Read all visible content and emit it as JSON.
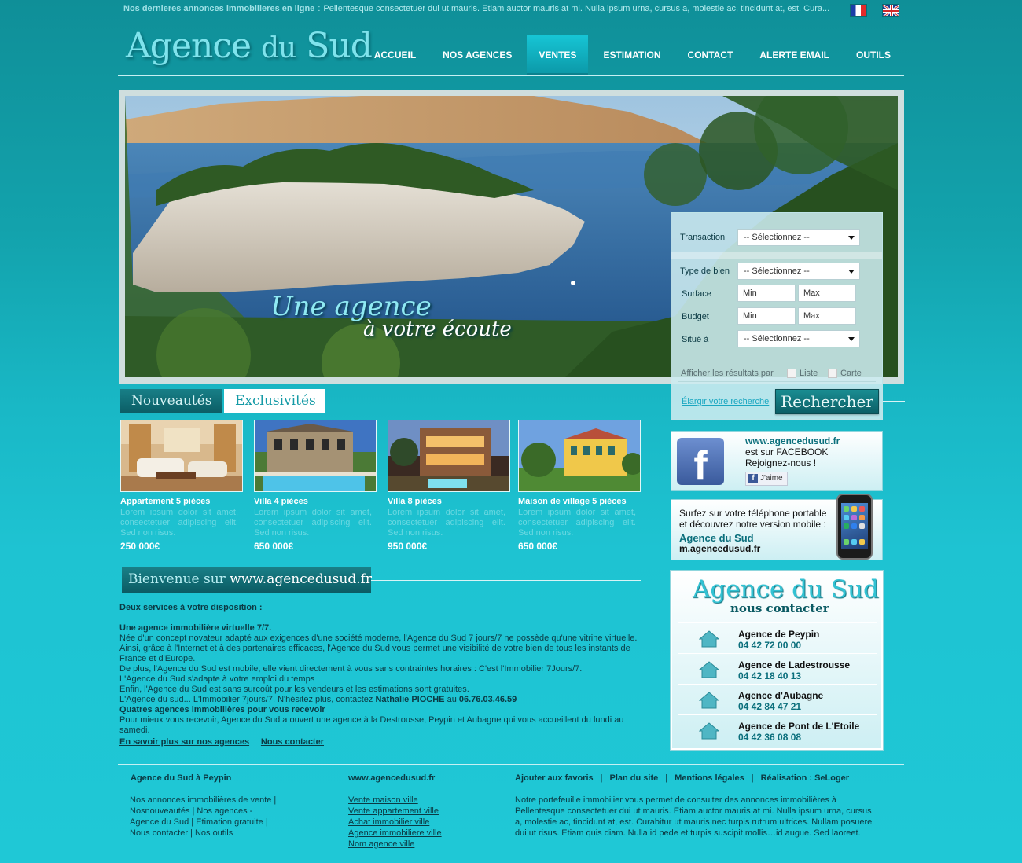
{
  "topbar": {
    "lead": "Nos dernieres annonces immobilieres en ligne",
    "separator": ":",
    "text": "Pellentesque consectetuer dui ut mauris. Etiam auctor mauris at mi. Nulla ipsum urna, cursus a, molestie ac, tincidunt at, est. Cura...",
    "languages": [
      "Français",
      "English"
    ]
  },
  "header": {
    "logo_part1": "Agence",
    "logo_part2": "du",
    "logo_part3": "Sud",
    "nav": [
      "ACCUEIL",
      "NOS AGENCES",
      "VENTES",
      "ESTIMATION",
      "CONTACT",
      "ALERTE EMAIL",
      "OUTILS"
    ],
    "active_nav": "VENTES"
  },
  "hero": {
    "slogan_line1": "Une agence",
    "slogan_line2": "à votre écoute"
  },
  "search": {
    "transaction_label": "Transaction",
    "transaction_value": "-- Sélectionnez --",
    "type_label": "Type de bien",
    "type_value": "-- Sélectionnez --",
    "surface_label": "Surface",
    "budget_label": "Budget",
    "min_placeholder": "Min",
    "max_placeholder": "Max",
    "situe_label": "Situé à",
    "situe_value": "-- Sélectionnez --",
    "display_label": "Afficher les résultats par",
    "list_label": "Liste",
    "map_label": "Carte",
    "enlarge_link": "Élargir votre recherche",
    "search_button": "Rechercher"
  },
  "tabs": [
    "Nouveautés",
    "Exclusivités"
  ],
  "listings": [
    {
      "title": "Appartement 5 pièces",
      "desc": "Lorem ipsum dolor sit amet, consectetuer adipiscing elit. Sed non risus.",
      "price": "250 000€"
    },
    {
      "title": "Villa 4 pièces",
      "desc": "Lorem ipsum dolor sit amet, consectetuer adipiscing elit. Sed non risus.",
      "price": "650 000€"
    },
    {
      "title": "Villa 8 pièces",
      "desc": "Lorem ipsum dolor sit amet, consectetuer adipiscing elit. Sed non risus.",
      "price": "950 000€"
    },
    {
      "title": "Maison de village 5 pièces",
      "desc": "Lorem ipsum dolor sit amet, consectetuer adipiscing elit. Sed non risus.",
      "price": "650 000€"
    }
  ],
  "welcome": {
    "heading_part1": "Bienvenue sur",
    "heading_part2": "www.agencedusud.fr",
    "intro": "Deux services à votre disposition :",
    "sub1": "Une agence immobilière virtuelle 7/7.",
    "p1": "Née d'un concept novateur adapté aux exigences d'une société moderne, l'Agence du Sud 7 jours/7 ne possède qu'une vitrine virtuelle.",
    "p2": "Ainsi, grâce à l'Internet et à des partenaires efficaces, l'Agence du Sud vous permet une visibilité de votre bien de tous les instants de France et d'Europe.",
    "p3": "De plus, l'Agence du Sud est mobile, elle vient directement à vous sans contraintes horaires : C'est l'Immobilier 7Jours/7.",
    "p4": "L'Agence du Sud s'adapte à votre emploi du temps",
    "p5": "Enfin, l'Agence du Sud est sans surcoût pour les vendeurs et les estimations sont gratuites.",
    "p6_start": "L'Agence du sud... L'Immobilier 7jours/7. N'hésitez plus, contactez",
    "p6_name": "Nathalie PIOCHE",
    "p6_mid": "au",
    "p6_phone": "06.76.03.46.59",
    "sub2": "Quatres agences immobilières pour vous recevoir",
    "p7": "Pour mieux vous recevoir, Agence du Sud a ouvert une agence à la Destrousse, Peypin et Aubagne qui vous accueillent du lundi au samedi.",
    "link1": "En savoir plus sur nos agences",
    "link_sep": "|",
    "link2": "Nous contacter"
  },
  "facebook": {
    "url": "www.agencedusud.fr",
    "line2": "est sur FACEBOOK",
    "line3": "Rejoignez-nous !",
    "like": "J'aime"
  },
  "mobile": {
    "line1": "Surfez sur votre téléphone portable",
    "line2": "et découvrez notre version mobile :",
    "name": "Agence du Sud",
    "url": "m.agencedusud.fr"
  },
  "contact": {
    "title": "Agence du Sud",
    "subtitle": "nous contacter",
    "agencies": [
      {
        "name": "Agence de Peypin",
        "phone": "04 42 72 00 00"
      },
      {
        "name": "Agence de Ladestrousse",
        "phone": "04 42 18 40 13"
      },
      {
        "name": "Agence d'Aubagne",
        "phone": "04 42 84 47 21"
      },
      {
        "name": "Agence de Pont de L'Etoile",
        "phone": "04 42 36 08 08"
      }
    ]
  },
  "footer": {
    "col1_title": "Agence du Sud à Peypin",
    "col1_text": "Nos annonces immobilières de vente | Nosnouveautés | Nos agences - Agence du Sud | Etimation gratuite | Nous contacter | Nos outils",
    "col2_title": "www.agencedusud.fr",
    "col2_links": [
      "Vente maison ville",
      "Vente appartement ville",
      "Achat immobilier ville",
      "Agence immobiliere ville",
      "Nom agence ville"
    ],
    "menu": [
      "Ajouter aux favoris",
      "Plan du site",
      "Mentions légales",
      "Réalisation : SeLoger"
    ],
    "menu_sep": "|",
    "col3_text": "Notre portefeuille immobilier vous permet de consulter des annonces immobilières à Pellentesque consectetuer dui ut mauris. Etiam auctor mauris at mi. Nulla ipsum urna, cursus a, molestie ac, tincidunt at, est. Curabitur ut mauris nec turpis rutrum ultrices. Nullam posuere dui ut risus. Etiam quis diam. Nulla id pede et turpis suscipit mollis…id augue. Sed laoreet."
  },
  "colors": {
    "background": "#1ec3d2",
    "dark_teal": "#0b5d65",
    "accent": "#17c6d6",
    "text": "#0b3a44"
  }
}
